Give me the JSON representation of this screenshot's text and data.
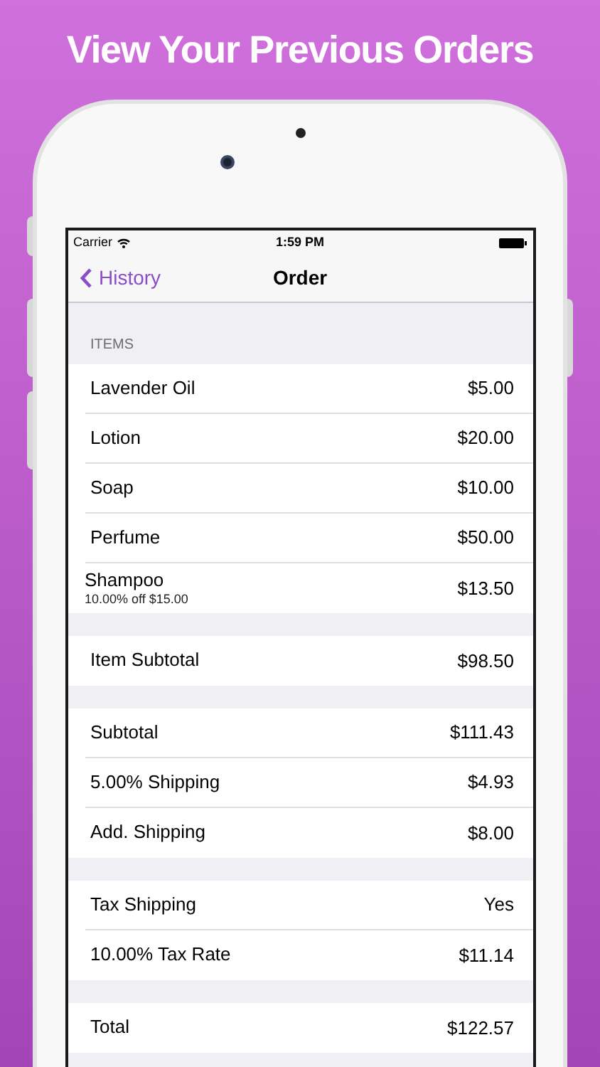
{
  "headline": "View Your Previous Orders",
  "status_bar": {
    "carrier": "Carrier",
    "time": "1:59 PM"
  },
  "nav": {
    "back_label": "History",
    "title": "Order"
  },
  "sections": [
    {
      "header": "ITEMS",
      "rows": [
        {
          "label": "Lavender Oil",
          "value": "$5.00"
        },
        {
          "label": "Lotion",
          "value": "$20.00"
        },
        {
          "label": "Soap",
          "value": "$10.00"
        },
        {
          "label": "Perfume",
          "value": "$50.00"
        },
        {
          "label": "Shampoo",
          "note": "10.00% off $15.00",
          "value": "$13.50"
        }
      ]
    },
    {
      "rows": [
        {
          "label": "Item Subtotal",
          "value": "$98.50"
        }
      ]
    },
    {
      "rows": [
        {
          "label": "Subtotal",
          "value": "$111.43"
        },
        {
          "label": "5.00% Shipping",
          "value": "$4.93"
        },
        {
          "label": "Add. Shipping",
          "value": "$8.00"
        }
      ]
    },
    {
      "rows": [
        {
          "label": "Tax Shipping",
          "value": "Yes"
        },
        {
          "label": "10.00% Tax Rate",
          "value": "$11.14"
        }
      ]
    },
    {
      "rows": [
        {
          "label": "Total",
          "value": "$122.57"
        }
      ]
    }
  ]
}
